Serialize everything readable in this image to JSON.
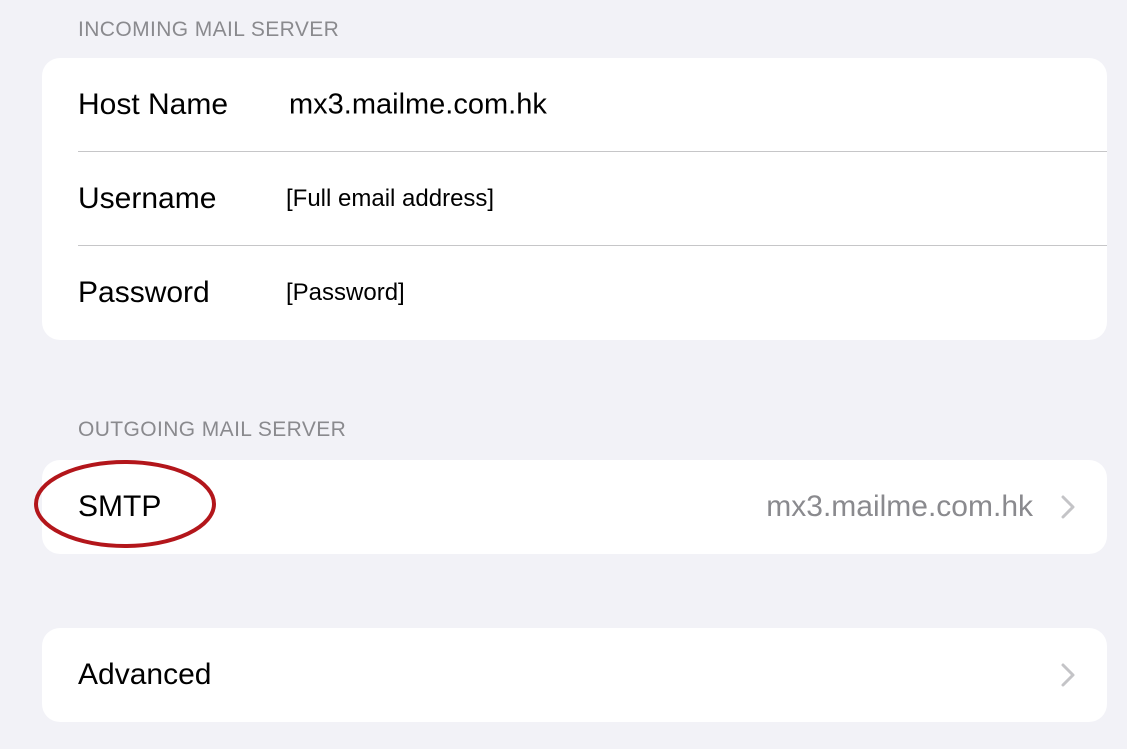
{
  "incoming": {
    "header": "INCOMING MAIL SERVER",
    "rows": [
      {
        "label": "Host Name",
        "value": "mx3.mailme.com.hk"
      },
      {
        "label": "Username",
        "value": "[Full email address]"
      },
      {
        "label": "Password",
        "value": "[Password]"
      }
    ]
  },
  "outgoing": {
    "header": "OUTGOING MAIL SERVER",
    "smtp_label": "SMTP",
    "smtp_value": "mx3.mailme.com.hk"
  },
  "advanced": {
    "label": "Advanced"
  },
  "icons": {
    "chevron": "chevron-right-icon"
  },
  "colors": {
    "background": "#f2f2f7",
    "card": "#ffffff",
    "secondary_text": "#8a8a8e",
    "separator": "#c6c6c8",
    "highlight_ring": "#b3161b",
    "chevron": "#c4c4c7"
  }
}
